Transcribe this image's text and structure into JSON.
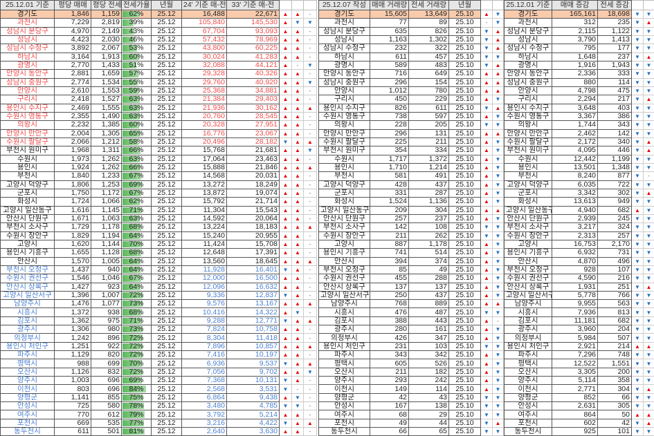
{
  "colors": {
    "red_group": "#ee4b4b",
    "blue_group": "#4a7fd0",
    "total_row": "#f8cbad",
    "up_arrow": "#e60000",
    "down_arrow": "#1f6fc0",
    "rate_bar": "#5cb85c"
  },
  "left": {
    "headers": [
      "25.12.01 기준",
      "평당 매매",
      "평당 전세",
      "전세가율",
      "년월",
      "24' 기준 매-전",
      "33' 기준 매-전"
    ],
    "rows": [
      [
        "경기도",
        "1,846",
        "1,159",
        "62%",
        "25.12",
        "16,488",
        "22,671",
        "uu-",
        "t"
      ],
      [
        "과천시",
        "7,229",
        "2,819",
        "39%",
        "25.12",
        "105,840",
        "145,530",
        "udd",
        "r"
      ],
      [
        "성남시 분당구",
        "4,970",
        "2,149",
        "43%",
        "25.12",
        "67,704",
        "93,093",
        "uu-",
        "r"
      ],
      [
        "성남시",
        "4,423",
        "2,030",
        "46%",
        "25.12",
        "57,432",
        "78,969",
        "uu-",
        "r"
      ],
      [
        "성남시 수정구",
        "3,892",
        "2,067",
        "53%",
        "25.12",
        "43,800",
        "60,225",
        "uu-",
        "r"
      ],
      [
        "하남시",
        "3,164",
        "1,913",
        "60%",
        "25.12",
        "30,024",
        "41,283",
        "uu-",
        "r"
      ],
      [
        "광명시",
        "2,770",
        "1,433",
        "51%",
        "25.12",
        "32,088",
        "44,121",
        "u-d",
        "r"
      ],
      [
        "안양시 동안구",
        "2,881",
        "1,659",
        "57%",
        "25.12",
        "29,328",
        "40,326",
        "uu-",
        "r"
      ],
      [
        "성남시 중원구",
        "2,774",
        "1,534",
        "55%",
        "25.12",
        "29,760",
        "40,920",
        "uud",
        "r"
      ],
      [
        "안양시",
        "2,610",
        "1,553",
        "59%",
        "25.12",
        "25,368",
        "34,881",
        "uu-",
        "r"
      ],
      [
        "구리시",
        "2,418",
        "1,527",
        "63%",
        "25.12",
        "21,384",
        "29,403",
        "uu-",
        "r"
      ],
      [
        "용인시 수지구",
        "2,469",
        "1,555",
        "63%",
        "25.12",
        "21,936",
        "30,162",
        "uuu",
        "r"
      ],
      [
        "수원시 영통구",
        "2,355",
        "1,490",
        "63%",
        "25.12",
        "20,760",
        "28,545",
        "uu-",
        "r"
      ],
      [
        "의왕시",
        "2,232",
        "1,385",
        "60%",
        "25.12",
        "20,328",
        "27,951",
        "uu-",
        "r"
      ],
      [
        "안양시 만안구",
        "2,004",
        "1,305",
        "65%",
        "25.12",
        "16,776",
        "23,067",
        "uu-",
        "r"
      ],
      [
        "수원시 팔달구",
        "2,066",
        "1,212",
        "58%",
        "25.12",
        "20,496",
        "28,182",
        "duu",
        "r"
      ],
      [
        "부천시 원미구",
        "1,968",
        "1,311",
        "66%",
        "25.12",
        "15,768",
        "21,681",
        "uud",
        "k"
      ],
      [
        "수원시",
        "1,973",
        "1,262",
        "63%",
        "25.12",
        "17,064",
        "23,463",
        "uu-",
        "k"
      ],
      [
        "용인시",
        "1,924",
        "1,262",
        "66%",
        "25.12",
        "15,888",
        "21,846",
        "uuu",
        "k"
      ],
      [
        "부천시",
        "1,840",
        "1,233",
        "67%",
        "25.12",
        "14,568",
        "20,031",
        "uu-",
        "k"
      ],
      [
        "고양시 덕양구",
        "1,806",
        "1,253",
        "69%",
        "25.12",
        "13,272",
        "18,249",
        "uu-",
        "k"
      ],
      [
        "군포시",
        "1,750",
        "1,172",
        "67%",
        "25.12",
        "13,872",
        "19,074",
        "uu-",
        "k"
      ],
      [
        "화성시",
        "1,724",
        "1,066",
        "62%",
        "25.12",
        "15,792",
        "21,714",
        "uu-",
        "k"
      ],
      [
        "고양시 일산동구",
        "1,616",
        "1,145",
        "71%",
        "25.12",
        "11,304",
        "15,543",
        "uu-",
        "k"
      ],
      [
        "안산시 단원구",
        "1,671",
        "1,063",
        "63%",
        "25.12",
        "14,592",
        "20,064",
        "uu-",
        "k"
      ],
      [
        "부천시 소사구",
        "1,729",
        "1,178",
        "68%",
        "25.12",
        "13,224",
        "18,183",
        "uuu",
        "k"
      ],
      [
        "수원시 장안구",
        "1,829",
        "1,194",
        "64%",
        "25.12",
        "15,240",
        "20,955",
        "uu-",
        "k"
      ],
      [
        "고양시",
        "1,620",
        "1,144",
        "70%",
        "25.12",
        "11,424",
        "15,708",
        "uu-",
        "k"
      ],
      [
        "용인시 기흥구",
        "1,655",
        "1,128",
        "68%",
        "25.12",
        "12,648",
        "17,391",
        "uu-",
        "k"
      ],
      [
        "안산시",
        "1,570",
        "1,005",
        "64%",
        "25.12",
        "13,560",
        "18,645",
        "uuu",
        "k"
      ],
      [
        "부천시 오정구",
        "1,437",
        "940",
        "64%",
        "25.12",
        "11,928",
        "16,401",
        "du-",
        "b"
      ],
      [
        "수원시 권선구",
        "1,546",
        "1,046",
        "67%",
        "25.12",
        "12,000",
        "16,500",
        "uu-",
        "b"
      ],
      [
        "안산시 상록구",
        "1,427",
        "923",
        "64%",
        "25.12",
        "12,096",
        "16,632",
        "uu-",
        "b"
      ],
      [
        "고양시 일산서구",
        "1,396",
        "1,007",
        "72%",
        "25.12",
        "9,336",
        "12,837",
        "du-",
        "b"
      ],
      [
        "남양주시",
        "1,476",
        "1,077",
        "73%",
        "25.12",
        "9,576",
        "13,167",
        "uuu",
        "b"
      ],
      [
        "시흥시",
        "1,372",
        "938",
        "68%",
        "25.12",
        "10,416",
        "14,322",
        "ud-",
        "b"
      ],
      [
        "김포시",
        "1,362",
        "975",
        "71%",
        "25.12",
        "9,288",
        "12,771",
        "duu",
        "b"
      ],
      [
        "광주시",
        "1,306",
        "980",
        "73%",
        "25.12",
        "7,824",
        "10,758",
        "uu-",
        "b"
      ],
      [
        "의정부시",
        "1,242",
        "896",
        "72%",
        "25.12",
        "8,304",
        "11,418",
        "uu-",
        "b"
      ],
      [
        "용인시 처인구",
        "1,251",
        "922",
        "72%",
        "25.12",
        "7,896",
        "10,857",
        "uuu",
        "b"
      ],
      [
        "파주시",
        "1,129",
        "820",
        "72%",
        "25.12",
        "7,416",
        "10,197",
        "uu-",
        "b"
      ],
      [
        "평택시",
        "988",
        "699",
        "70%",
        "25.12",
        "6,936",
        "9,537",
        "duu",
        "b"
      ],
      [
        "오산시",
        "1,126",
        "832",
        "72%",
        "25.12",
        "7,056",
        "9,702",
        "uud",
        "b"
      ],
      [
        "양주시",
        "1,003",
        "696",
        "69%",
        "25.12",
        "7,368",
        "10,131",
        "du-",
        "b"
      ],
      [
        "이천시",
        "803",
        "696",
        "84%",
        "25.12",
        "2,568",
        "3,531",
        "d--",
        "b"
      ],
      [
        "양평군",
        "1,141",
        "855",
        "75%",
        "25.12",
        "6,864",
        "9,438",
        "ud-",
        "b"
      ],
      [
        "안성시",
        "725",
        "580",
        "78%",
        "25.12",
        "3,480",
        "4,785",
        "dd-",
        "b"
      ],
      [
        "여주시",
        "770",
        "612",
        "79%",
        "25.12",
        "3,792",
        "5,214",
        "uu-",
        "b"
      ],
      [
        "포천시",
        "669",
        "535",
        "77%",
        "25.12",
        "3,216",
        "4,422",
        "duu",
        "b"
      ],
      [
        "동두천시",
        "611",
        "501",
        "81%",
        "25.12",
        "2,640",
        "3,630",
        "uu-",
        "b"
      ]
    ]
  },
  "middle": {
    "headers": [
      "25.12.07 작성",
      "매매 거래량",
      "전세 거래량",
      "년월"
    ],
    "rows": [
      [
        "15,605",
        "13,649",
        "25.10",
        "ud"
      ],
      [
        "77",
        "89",
        "25.10",
        "-d"
      ],
      [
        "635",
        "826",
        "25.10",
        "du"
      ],
      [
        "1,163",
        "1,302",
        "25.10",
        "du"
      ],
      [
        "232",
        "322",
        "25.10",
        "du"
      ],
      [
        "611",
        "457",
        "25.10",
        "dd"
      ],
      [
        "589",
        "483",
        "25.10",
        "du"
      ],
      [
        "716",
        "649",
        "25.10",
        "uu"
      ],
      [
        "296",
        "154",
        "25.10",
        "uu"
      ],
      [
        "1,012",
        "780",
        "25.10",
        "uu"
      ],
      [
        "450",
        "229",
        "25.10",
        "ud"
      ],
      [
        "826",
        "611",
        "25.10",
        "du"
      ],
      [
        "738",
        "597",
        "25.10",
        "ud"
      ],
      [
        "228",
        "205",
        "25.10",
        "dd"
      ],
      [
        "296",
        "131",
        "25.10",
        "uu"
      ],
      [
        "225",
        "211",
        "25.10",
        "ud"
      ],
      [
        "354",
        "334",
        "25.10",
        "ud"
      ],
      [
        "1,717",
        "1,372",
        "25.10",
        "ud"
      ],
      [
        "1,710",
        "1,214",
        "25.10",
        "ud"
      ],
      [
        "581",
        "491",
        "25.10",
        "ud"
      ],
      [
        "428",
        "437",
        "25.10",
        "ud"
      ],
      [
        "331",
        "287",
        "25.10",
        "ud"
      ],
      [
        "1,524",
        "1,136",
        "25.10",
        "ud"
      ],
      [
        "209",
        "304",
        "25.10",
        "uu"
      ],
      [
        "257",
        "237",
        "25.10",
        "ud"
      ],
      [
        "142",
        "108",
        "25.10",
        "dd"
      ],
      [
        "211",
        "262",
        "25.10",
        "dd"
      ],
      [
        "887",
        "1,178",
        "25.10",
        "ud"
      ],
      [
        "741",
        "514",
        "25.10",
        "ud"
      ],
      [
        "394",
        "374",
        "25.10",
        "ud"
      ],
      [
        "85",
        "49",
        "25.10",
        "ud"
      ],
      [
        "455",
        "288",
        "25.10",
        "ud"
      ],
      [
        "137",
        "137",
        "25.10",
        "ud"
      ],
      [
        "250",
        "437",
        "25.10",
        "ud"
      ],
      [
        "768",
        "889",
        "25.10",
        "uu"
      ],
      [
        "476",
        "487",
        "25.10",
        "dd"
      ],
      [
        "388",
        "443",
        "25.10",
        "u-"
      ],
      [
        "280",
        "161",
        "25.10",
        "ud"
      ],
      [
        "426",
        "347",
        "25.10",
        "ud"
      ],
      [
        "231",
        "103",
        "25.10",
        "dd"
      ],
      [
        "343",
        "342",
        "25.10",
        "ud"
      ],
      [
        "605",
        "526",
        "25.10",
        "ud"
      ],
      [
        "211",
        "182",
        "25.10",
        "ud"
      ],
      [
        "293",
        "242",
        "25.10",
        "ud"
      ],
      [
        "149",
        "114",
        "25.10",
        "ud"
      ],
      [
        "42",
        "43",
        "25.10",
        "dd"
      ],
      [
        "167",
        "138",
        "25.10",
        "dd"
      ],
      [
        "68",
        "29",
        "25.10",
        "dd"
      ],
      [
        "49",
        "44",
        "25.10",
        "du"
      ],
      [
        "66",
        "65",
        "25.10",
        "dd"
      ]
    ]
  },
  "right": {
    "headers": [
      "25.12.01 기준",
      "매매 증감",
      "전세 증감"
    ],
    "rows": [
      [
        "165,161",
        "18,698",
        "dd"
      ],
      [
        "312",
        "235",
        "du"
      ],
      [
        "2,115",
        "1,122",
        "dd"
      ],
      [
        "3,790",
        "1,413",
        "dd"
      ],
      [
        "795",
        "177",
        "dd"
      ],
      [
        "1,648",
        "237",
        "du"
      ],
      [
        "1,916",
        "1,943",
        "dd"
      ],
      [
        "2,336",
        "333",
        "dd"
      ],
      [
        "880",
        "114",
        "dd"
      ],
      [
        "4,798",
        "475",
        "dd"
      ],
      [
        "2,294",
        "217",
        "du"
      ],
      [
        "3,648",
        "403",
        "dd"
      ],
      [
        "3,367",
        "386",
        "dd"
      ],
      [
        "1,744",
        "343",
        "dd"
      ],
      [
        "2,462",
        "142",
        "dd"
      ],
      [
        "2,172",
        "340",
        "du"
      ],
      [
        "4,095",
        "446",
        "du"
      ],
      [
        "12,442",
        "1,199",
        "dd"
      ],
      [
        "13,501",
        "1,348",
        "dd"
      ],
      [
        "8,240",
        "877",
        "d-"
      ],
      [
        "6,035",
        "722",
        "dd"
      ],
      [
        "3,342",
        "302",
        "du"
      ],
      [
        "13,613",
        "949",
        "dd"
      ],
      [
        "4,940",
        "682",
        "ud"
      ],
      [
        "2,939",
        "245",
        "dd"
      ],
      [
        "3,217",
        "324",
        "dd"
      ],
      [
        "2,313",
        "257",
        "dd"
      ],
      [
        "16,753",
        "2,170",
        "dd"
      ],
      [
        "6,932",
        "731",
        "dd"
      ],
      [
        "4,870",
        "496",
        "dd"
      ],
      [
        "928",
        "107",
        "dd"
      ],
      [
        "4,590",
        "216",
        "dd"
      ],
      [
        "1,931",
        "251",
        "du"
      ],
      [
        "5,778",
        "766",
        "dd"
      ],
      [
        "9,955",
        "563",
        "dd"
      ],
      [
        "7,936",
        "813",
        "dd"
      ],
      [
        "11,181",
        "682",
        "dd"
      ],
      [
        "3,960",
        "204",
        "dd"
      ],
      [
        "5,984",
        "507",
        "dd"
      ],
      [
        "2,921",
        "214",
        "uu"
      ],
      [
        "7,296",
        "748",
        "dd"
      ],
      [
        "12,522",
        "1,551",
        "dd"
      ],
      [
        "3,305",
        "200",
        "dd"
      ],
      [
        "5,114",
        "358",
        "dd"
      ],
      [
        "2,771",
        "304",
        "du"
      ],
      [
        "852",
        "66",
        "dd"
      ],
      [
        "2,631",
        "305",
        "dd"
      ],
      [
        "864",
        "50",
        "uu"
      ],
      [
        "602",
        "42",
        "du"
      ],
      [
        "925",
        "101",
        "dd"
      ]
    ]
  }
}
